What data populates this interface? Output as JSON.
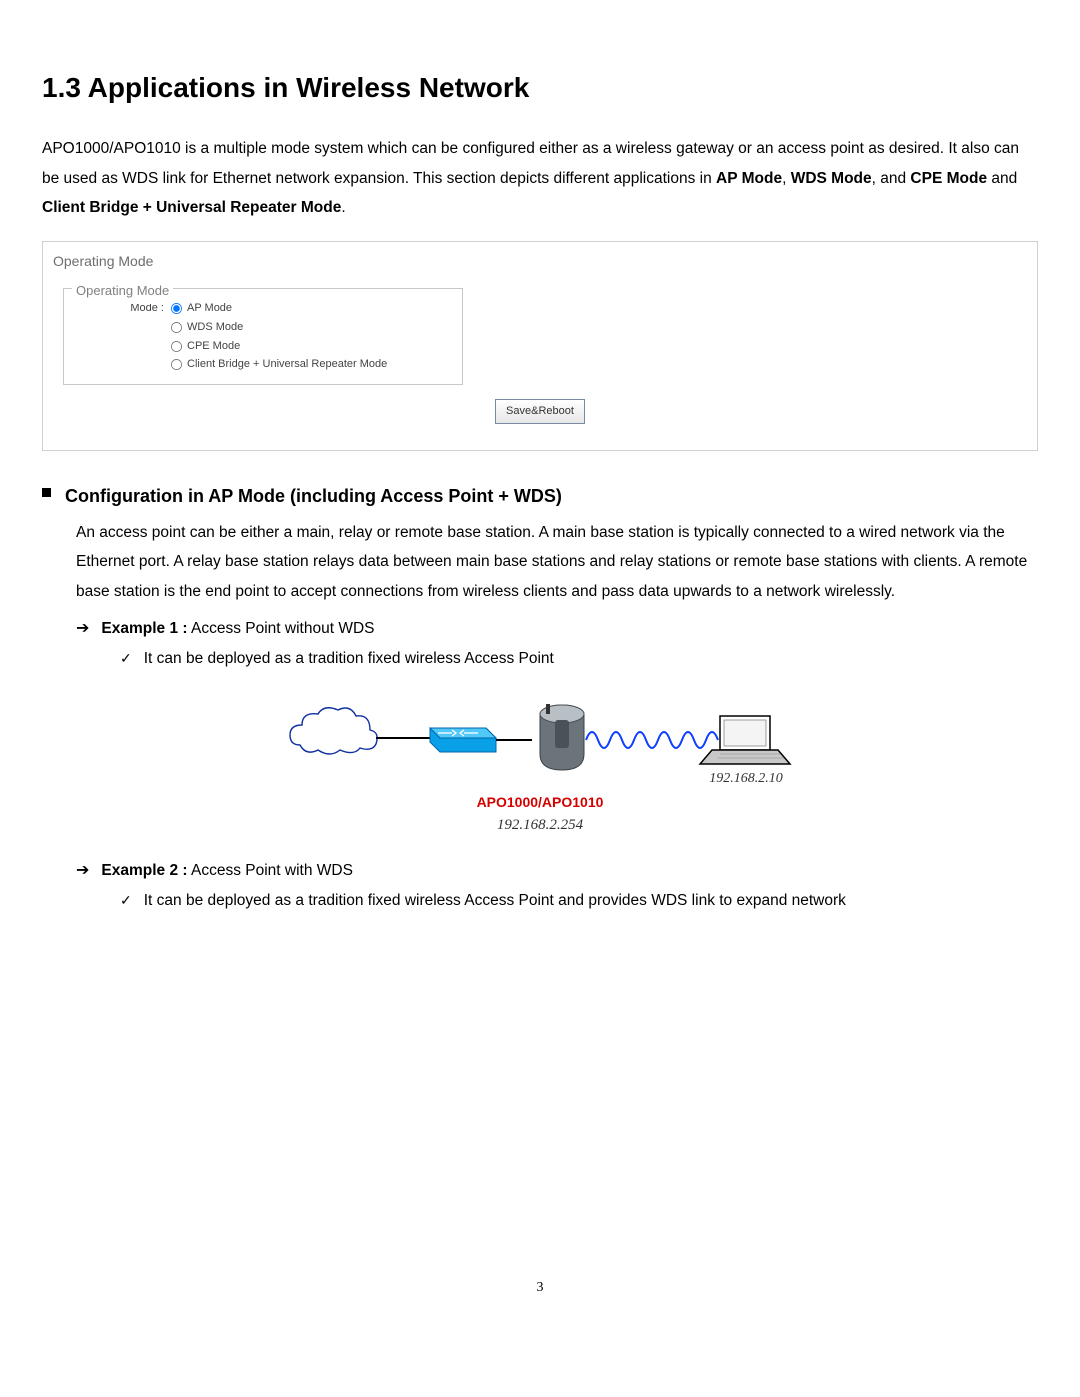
{
  "title": "1.3 Applications in Wireless Network",
  "intro_plain_1": "APO1000/APO1010 is a multiple mode system which can be configured either as a wireless gateway or an access point as desired. It also can be used as WDS link for Ethernet network expansion. This section depicts different applications in ",
  "intro_bold_1": "AP Mode",
  "intro_sep_1": ", ",
  "intro_bold_2": "WDS Mode",
  "intro_sep_2": ", and ",
  "intro_bold_3": "CPE Mode",
  "intro_sep_3": " and ",
  "intro_bold_4": "Client Bridge + Universal Repeater Mode",
  "intro_end": ".",
  "om": {
    "outer_title": "Operating Mode",
    "legend": "Operating Mode",
    "label": "Mode :",
    "opts": [
      "AP Mode",
      "WDS Mode",
      "CPE Mode",
      "Client Bridge + Universal Repeater Mode"
    ],
    "save": "Save&Reboot"
  },
  "sec": {
    "heading": "Configuration in AP Mode (including Access Point + WDS)",
    "para": "An access point can be either a main, relay or remote base station. A main base station is typically connected to a wired network via the Ethernet port. A relay base station relays data between main base stations and relay stations or remote base stations with clients.  A remote base station is the end point to accept connections from wireless clients and pass data upwards to a network wirelessly."
  },
  "ex1": {
    "label": "Example 1 :",
    "rest": " Access Point without WDS",
    "bullet": "It can be deployed as a tradition fixed wireless Access Point"
  },
  "diagram": {
    "device_label": "APO1000/APO1010",
    "device_ip": "192.168.2.254",
    "client_ip": "192.168.2.10"
  },
  "ex2": {
    "label": "Example 2 :",
    "rest": " Access Point with WDS",
    "bullet": "It can be deployed as a tradition fixed wireless Access Point and provides WDS link to expand network"
  },
  "page_number": "3"
}
